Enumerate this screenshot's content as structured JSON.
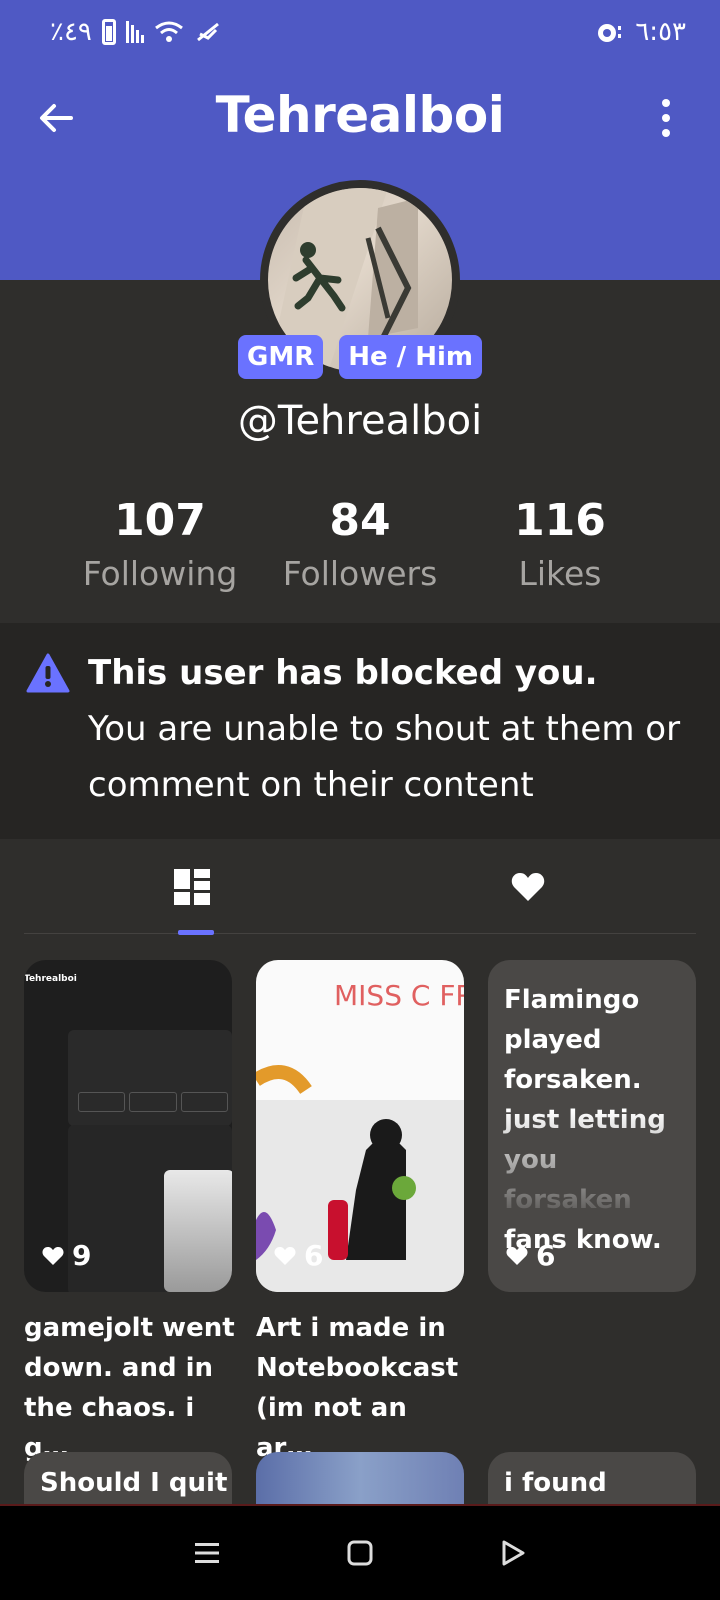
{
  "status_bar": {
    "battery_percent": "٪٤٩",
    "time": "٦:٥٣"
  },
  "app_bar": {
    "title": "Tehrealboi",
    "back_icon": "arrow-left-icon",
    "more_icon": "more-vertical-icon"
  },
  "profile": {
    "badges": [
      "GMR",
      "He / Him"
    ],
    "handle": "@Tehrealboi",
    "stats": [
      {
        "count": "107",
        "label": "Following"
      },
      {
        "count": "84",
        "label": "Followers"
      },
      {
        "count": "116",
        "label": "Likes"
      }
    ]
  },
  "notice": {
    "title": "This user has blocked you.",
    "body": "You are unable to shout at them or comment on their content"
  },
  "tabs": [
    {
      "icon": "grid-icon",
      "selected": true
    },
    {
      "icon": "heart-icon",
      "selected": false
    }
  ],
  "posts": [
    {
      "likes": "9",
      "caption": "gamejolt went down. and in the chaos. i g…",
      "thumb_title": "Tehrealboi"
    },
    {
      "likes": "6",
      "caption": "Art i made in Notebookcast (im not an ar…",
      "thumb_text": "MISS C FREE"
    },
    {
      "likes": "6",
      "text": "Flamingo played forsaken. just letting you forsaken fans know."
    }
  ],
  "posts_row2": [
    {
      "text": "Should I quit"
    },
    {
      "text": ""
    },
    {
      "text": "i found"
    }
  ],
  "colors": {
    "accent": "#4f59c4",
    "badge": "#6a72ff",
    "background": "#2f2e2c"
  }
}
